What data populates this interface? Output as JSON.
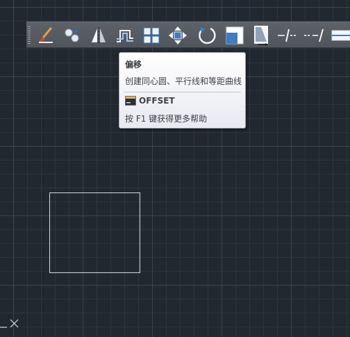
{
  "toolbar": {
    "buttons": [
      {
        "name": "erase-button",
        "icon": "eraser-brush-icon",
        "label": "删除"
      },
      {
        "name": "copy-button",
        "icon": "copy-objects-icon",
        "label": "复制"
      },
      {
        "name": "mirror-button",
        "icon": "mirror-icon",
        "label": "镜像"
      },
      {
        "name": "offset-button",
        "icon": "offset-icon",
        "label": "偏移"
      },
      {
        "name": "array-button",
        "icon": "array-icon",
        "label": "阵列"
      },
      {
        "name": "move-button",
        "icon": "move-arrows-icon",
        "label": "移动"
      },
      {
        "name": "rotate-button",
        "icon": "rotate-icon",
        "label": "旋转"
      },
      {
        "name": "scale-button",
        "icon": "scale-icon",
        "label": "缩放"
      },
      {
        "name": "stretch-button",
        "icon": "stretch-icon",
        "label": "拉伸"
      },
      {
        "name": "trim-button",
        "icon": "trim-icon",
        "label": "修剪"
      },
      {
        "name": "extend-button",
        "icon": "extend-icon",
        "label": "延伸"
      },
      {
        "name": "break-button",
        "icon": "break-icon",
        "label": "打断"
      }
    ]
  },
  "tooltip": {
    "title": "偏移",
    "description": "创建同心圆、平行线和等距曲线",
    "command": "OFFSET",
    "help_hint": "按 F1 键获得更多帮助"
  },
  "colors": {
    "canvas_background": "#212830",
    "grid_line": "#3a4350",
    "toolbar_background": "#565b62",
    "rectangle_stroke": "#d8dbe0",
    "tooltip_text": "#3d4046"
  }
}
